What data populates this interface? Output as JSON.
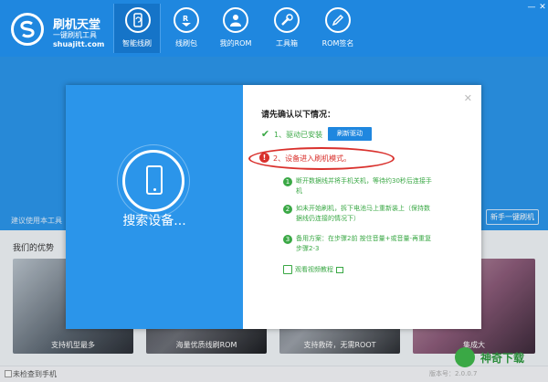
{
  "app": {
    "name": "刷机天堂",
    "tagline": "一键刷机工具",
    "url": "shuajitt.com"
  },
  "nav": [
    {
      "label": "智能线刷",
      "icon": "phone-refresh-icon",
      "active": true
    },
    {
      "label": "线刷包",
      "icon": "rom-package-icon",
      "active": false
    },
    {
      "label": "我的ROM",
      "icon": "user-icon",
      "active": false
    },
    {
      "label": "工具箱",
      "icon": "wrench-icon",
      "active": false
    },
    {
      "label": "ROM签名",
      "icon": "pen-icon",
      "active": false
    }
  ],
  "window": {
    "minimize": "—",
    "close": "✕"
  },
  "banner": {
    "hint": "建议使用本工具",
    "oneclick_button": "新手一键刷机"
  },
  "advantages": {
    "title": "我们的优势",
    "cards": [
      {
        "label": "支持机型最多"
      },
      {
        "label": "海量优质线刷ROM"
      },
      {
        "label": "支持救砖，无需ROOT"
      },
      {
        "label": "集成大"
      }
    ]
  },
  "bottom": {
    "checkbox_label": "未检查到手机",
    "version": "版本号：2.0.0.7"
  },
  "dialog": {
    "search_label": "搜索设备...",
    "close": "✕",
    "confirm_title": "请先确认以下情况：",
    "step1": "1、驱动已安装",
    "refresh_button": "刷新驱动",
    "step2": "2、设备进入刷机模式。",
    "substeps": [
      {
        "num": "1",
        "text": "断开数据线并将手机关机，等待约30秒后连接手机"
      },
      {
        "num": "2",
        "text": "如未开始刷机，拆下电池马上重新装上（保持数据线仍连接的情况下）"
      },
      {
        "num": "3",
        "text": "备用方案：在步骤2前 按住音量+或音量-再重复步骤2-3"
      }
    ],
    "video_link": "观看视频教程"
  },
  "watermark": {
    "text": "神奇下载"
  },
  "colors": {
    "header_blue": "#1f87df",
    "banner_blue": "#2b95ea",
    "success_green": "#3aa845",
    "alert_red": "#d9302c"
  }
}
